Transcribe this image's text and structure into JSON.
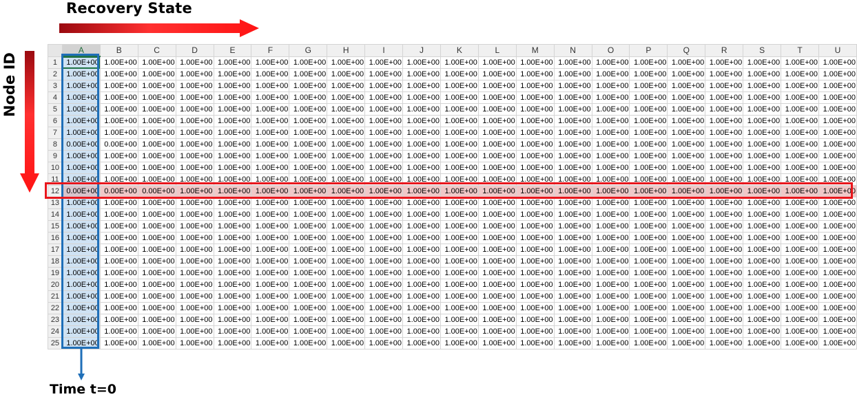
{
  "labels": {
    "top": "Recovery State",
    "left": "Node ID",
    "bottom": "Time t=0"
  },
  "colors": {
    "highlight_row_border": "#e8161c",
    "highlight_row_fill": "#f0c8c8",
    "time_column_border": "#1f6fb8",
    "time_column_fill": "#cfe2f3",
    "arrow_red": "#ff1a1a"
  },
  "spreadsheet": {
    "columns": [
      "A",
      "B",
      "C",
      "D",
      "E",
      "F",
      "G",
      "H",
      "I",
      "J",
      "K",
      "L",
      "M",
      "N",
      "O",
      "P",
      "Q",
      "R",
      "S",
      "T",
      "U"
    ],
    "highlighted_row": 12,
    "rows": [
      {
        "id": "1",
        "cells": [
          "1.00E+00",
          "1.00E+00",
          "1.00E+00",
          "1.00E+00",
          "1.00E+00",
          "1.00E+00",
          "1.00E+00",
          "1.00E+00",
          "1.00E+00",
          "1.00E+00",
          "1.00E+00",
          "1.00E+00",
          "1.00E+00",
          "1.00E+00",
          "1.00E+00",
          "1.00E+00",
          "1.00E+00",
          "1.00E+00",
          "1.00E+00",
          "1.00E+00",
          "1.00E+00"
        ]
      },
      {
        "id": "2",
        "cells": [
          "1.00E+00",
          "1.00E+00",
          "1.00E+00",
          "1.00E+00",
          "1.00E+00",
          "1.00E+00",
          "1.00E+00",
          "1.00E+00",
          "1.00E+00",
          "1.00E+00",
          "1.00E+00",
          "1.00E+00",
          "1.00E+00",
          "1.00E+00",
          "1.00E+00",
          "1.00E+00",
          "1.00E+00",
          "1.00E+00",
          "1.00E+00",
          "1.00E+00",
          "1.00E+00"
        ]
      },
      {
        "id": "3",
        "cells": [
          "1.00E+00",
          "1.00E+00",
          "1.00E+00",
          "1.00E+00",
          "1.00E+00",
          "1.00E+00",
          "1.00E+00",
          "1.00E+00",
          "1.00E+00",
          "1.00E+00",
          "1.00E+00",
          "1.00E+00",
          "1.00E+00",
          "1.00E+00",
          "1.00E+00",
          "1.00E+00",
          "1.00E+00",
          "1.00E+00",
          "1.00E+00",
          "1.00E+00",
          "1.00E+00"
        ]
      },
      {
        "id": "4",
        "cells": [
          "1.00E+00",
          "1.00E+00",
          "1.00E+00",
          "1.00E+00",
          "1.00E+00",
          "1.00E+00",
          "1.00E+00",
          "1.00E+00",
          "1.00E+00",
          "1.00E+00",
          "1.00E+00",
          "1.00E+00",
          "1.00E+00",
          "1.00E+00",
          "1.00E+00",
          "1.00E+00",
          "1.00E+00",
          "1.00E+00",
          "1.00E+00",
          "1.00E+00",
          "1.00E+00"
        ]
      },
      {
        "id": "5",
        "cells": [
          "1.00E+00",
          "1.00E+00",
          "1.00E+00",
          "1.00E+00",
          "1.00E+00",
          "1.00E+00",
          "1.00E+00",
          "1.00E+00",
          "1.00E+00",
          "1.00E+00",
          "1.00E+00",
          "1.00E+00",
          "1.00E+00",
          "1.00E+00",
          "1.00E+00",
          "1.00E+00",
          "1.00E+00",
          "1.00E+00",
          "1.00E+00",
          "1.00E+00",
          "1.00E+00"
        ]
      },
      {
        "id": "6",
        "cells": [
          "1.00E+00",
          "1.00E+00",
          "1.00E+00",
          "1.00E+00",
          "1.00E+00",
          "1.00E+00",
          "1.00E+00",
          "1.00E+00",
          "1.00E+00",
          "1.00E+00",
          "1.00E+00",
          "1.00E+00",
          "1.00E+00",
          "1.00E+00",
          "1.00E+00",
          "1.00E+00",
          "1.00E+00",
          "1.00E+00",
          "1.00E+00",
          "1.00E+00",
          "1.00E+00"
        ]
      },
      {
        "id": "7",
        "cells": [
          "1.00E+00",
          "1.00E+00",
          "1.00E+00",
          "1.00E+00",
          "1.00E+00",
          "1.00E+00",
          "1.00E+00",
          "1.00E+00",
          "1.00E+00",
          "1.00E+00",
          "1.00E+00",
          "1.00E+00",
          "1.00E+00",
          "1.00E+00",
          "1.00E+00",
          "1.00E+00",
          "1.00E+00",
          "1.00E+00",
          "1.00E+00",
          "1.00E+00",
          "1.00E+00"
        ]
      },
      {
        "id": "8",
        "cells": [
          "0.00E+00",
          "0.00E+00",
          "1.00E+00",
          "1.00E+00",
          "1.00E+00",
          "1.00E+00",
          "1.00E+00",
          "1.00E+00",
          "1.00E+00",
          "1.00E+00",
          "1.00E+00",
          "1.00E+00",
          "1.00E+00",
          "1.00E+00",
          "1.00E+00",
          "1.00E+00",
          "1.00E+00",
          "1.00E+00",
          "1.00E+00",
          "1.00E+00",
          "1.00E+00"
        ]
      },
      {
        "id": "9",
        "cells": [
          "1.00E+00",
          "1.00E+00",
          "1.00E+00",
          "1.00E+00",
          "1.00E+00",
          "1.00E+00",
          "1.00E+00",
          "1.00E+00",
          "1.00E+00",
          "1.00E+00",
          "1.00E+00",
          "1.00E+00",
          "1.00E+00",
          "1.00E+00",
          "1.00E+00",
          "1.00E+00",
          "1.00E+00",
          "1.00E+00",
          "1.00E+00",
          "1.00E+00",
          "1.00E+00"
        ]
      },
      {
        "id": "10",
        "cells": [
          "1.00E+00",
          "1.00E+00",
          "1.00E+00",
          "1.00E+00",
          "1.00E+00",
          "1.00E+00",
          "1.00E+00",
          "1.00E+00",
          "1.00E+00",
          "1.00E+00",
          "1.00E+00",
          "1.00E+00",
          "1.00E+00",
          "1.00E+00",
          "1.00E+00",
          "1.00E+00",
          "1.00E+00",
          "1.00E+00",
          "1.00E+00",
          "1.00E+00",
          "1.00E+00"
        ]
      },
      {
        "id": "11",
        "cells": [
          "1.00E+00",
          "1.00E+00",
          "1.00E+00",
          "1.00E+00",
          "1.00E+00",
          "1.00E+00",
          "1.00E+00",
          "1.00E+00",
          "1.00E+00",
          "1.00E+00",
          "1.00E+00",
          "1.00E+00",
          "1.00E+00",
          "1.00E+00",
          "1.00E+00",
          "1.00E+00",
          "1.00E+00",
          "1.00E+00",
          "1.00E+00",
          "1.00E+00",
          "1.00E+00"
        ]
      },
      {
        "id": "12",
        "cells": [
          "0.00E+00",
          "0.00E+00",
          "0.00E+00",
          "1.00E+00",
          "1.00E+00",
          "1.00E+00",
          "1.00E+00",
          "1.00E+00",
          "1.00E+00",
          "1.00E+00",
          "1.00E+00",
          "1.00E+00",
          "1.00E+00",
          "1.00E+00",
          "1.00E+00",
          "1.00E+00",
          "1.00E+00",
          "1.00E+00",
          "1.00E+00",
          "1.00E+00",
          "1.00E+00"
        ]
      },
      {
        "id": "13",
        "cells": [
          "1.00E+00",
          "1.00E+00",
          "1.00E+00",
          "1.00E+00",
          "1.00E+00",
          "1.00E+00",
          "1.00E+00",
          "1.00E+00",
          "1.00E+00",
          "1.00E+00",
          "1.00E+00",
          "1.00E+00",
          "1.00E+00",
          "1.00E+00",
          "1.00E+00",
          "1.00E+00",
          "1.00E+00",
          "1.00E+00",
          "1.00E+00",
          "1.00E+00",
          "1.00E+00"
        ]
      },
      {
        "id": "14",
        "cells": [
          "1.00E+00",
          "1.00E+00",
          "1.00E+00",
          "1.00E+00",
          "1.00E+00",
          "1.00E+00",
          "1.00E+00",
          "1.00E+00",
          "1.00E+00",
          "1.00E+00",
          "1.00E+00",
          "1.00E+00",
          "1.00E+00",
          "1.00E+00",
          "1.00E+00",
          "1.00E+00",
          "1.00E+00",
          "1.00E+00",
          "1.00E+00",
          "1.00E+00",
          "1.00E+00"
        ]
      },
      {
        "id": "15",
        "cells": [
          "1.00E+00",
          "1.00E+00",
          "1.00E+00",
          "1.00E+00",
          "1.00E+00",
          "1.00E+00",
          "1.00E+00",
          "1.00E+00",
          "1.00E+00",
          "1.00E+00",
          "1.00E+00",
          "1.00E+00",
          "1.00E+00",
          "1.00E+00",
          "1.00E+00",
          "1.00E+00",
          "1.00E+00",
          "1.00E+00",
          "1.00E+00",
          "1.00E+00",
          "1.00E+00"
        ]
      },
      {
        "id": "16",
        "cells": [
          "1.00E+00",
          "1.00E+00",
          "1.00E+00",
          "1.00E+00",
          "1.00E+00",
          "1.00E+00",
          "1.00E+00",
          "1.00E+00",
          "1.00E+00",
          "1.00E+00",
          "1.00E+00",
          "1.00E+00",
          "1.00E+00",
          "1.00E+00",
          "1.00E+00",
          "1.00E+00",
          "1.00E+00",
          "1.00E+00",
          "1.00E+00",
          "1.00E+00",
          "1.00E+00"
        ]
      },
      {
        "id": "17",
        "cells": [
          "1.00E+00",
          "1.00E+00",
          "1.00E+00",
          "1.00E+00",
          "1.00E+00",
          "1.00E+00",
          "1.00E+00",
          "1.00E+00",
          "1.00E+00",
          "1.00E+00",
          "1.00E+00",
          "1.00E+00",
          "1.00E+00",
          "1.00E+00",
          "1.00E+00",
          "1.00E+00",
          "1.00E+00",
          "1.00E+00",
          "1.00E+00",
          "1.00E+00",
          "1.00E+00"
        ]
      },
      {
        "id": "18",
        "cells": [
          "1.00E+00",
          "1.00E+00",
          "1.00E+00",
          "1.00E+00",
          "1.00E+00",
          "1.00E+00",
          "1.00E+00",
          "1.00E+00",
          "1.00E+00",
          "1.00E+00",
          "1.00E+00",
          "1.00E+00",
          "1.00E+00",
          "1.00E+00",
          "1.00E+00",
          "1.00E+00",
          "1.00E+00",
          "1.00E+00",
          "1.00E+00",
          "1.00E+00",
          "1.00E+00"
        ]
      },
      {
        "id": "19",
        "cells": [
          "1.00E+00",
          "1.00E+00",
          "1.00E+00",
          "1.00E+00",
          "1.00E+00",
          "1.00E+00",
          "1.00E+00",
          "1.00E+00",
          "1.00E+00",
          "1.00E+00",
          "1.00E+00",
          "1.00E+00",
          "1.00E+00",
          "1.00E+00",
          "1.00E+00",
          "1.00E+00",
          "1.00E+00",
          "1.00E+00",
          "1.00E+00",
          "1.00E+00",
          "1.00E+00"
        ]
      },
      {
        "id": "20",
        "cells": [
          "1.00E+00",
          "1.00E+00",
          "1.00E+00",
          "1.00E+00",
          "1.00E+00",
          "1.00E+00",
          "1.00E+00",
          "1.00E+00",
          "1.00E+00",
          "1.00E+00",
          "1.00E+00",
          "1.00E+00",
          "1.00E+00",
          "1.00E+00",
          "1.00E+00",
          "1.00E+00",
          "1.00E+00",
          "1.00E+00",
          "1.00E+00",
          "1.00E+00",
          "1.00E+00"
        ]
      },
      {
        "id": "21",
        "cells": [
          "1.00E+00",
          "1.00E+00",
          "1.00E+00",
          "1.00E+00",
          "1.00E+00",
          "1.00E+00",
          "1.00E+00",
          "1.00E+00",
          "1.00E+00",
          "1.00E+00",
          "1.00E+00",
          "1.00E+00",
          "1.00E+00",
          "1.00E+00",
          "1.00E+00",
          "1.00E+00",
          "1.00E+00",
          "1.00E+00",
          "1.00E+00",
          "1.00E+00",
          "1.00E+00"
        ]
      },
      {
        "id": "22",
        "cells": [
          "1.00E+00",
          "1.00E+00",
          "1.00E+00",
          "1.00E+00",
          "1.00E+00",
          "1.00E+00",
          "1.00E+00",
          "1.00E+00",
          "1.00E+00",
          "1.00E+00",
          "1.00E+00",
          "1.00E+00",
          "1.00E+00",
          "1.00E+00",
          "1.00E+00",
          "1.00E+00",
          "1.00E+00",
          "1.00E+00",
          "1.00E+00",
          "1.00E+00",
          "1.00E+00"
        ]
      },
      {
        "id": "23",
        "cells": [
          "1.00E+00",
          "1.00E+00",
          "1.00E+00",
          "1.00E+00",
          "1.00E+00",
          "1.00E+00",
          "1.00E+00",
          "1.00E+00",
          "1.00E+00",
          "1.00E+00",
          "1.00E+00",
          "1.00E+00",
          "1.00E+00",
          "1.00E+00",
          "1.00E+00",
          "1.00E+00",
          "1.00E+00",
          "1.00E+00",
          "1.00E+00",
          "1.00E+00",
          "1.00E+00"
        ]
      },
      {
        "id": "24",
        "cells": [
          "1.00E+00",
          "1.00E+00",
          "1.00E+00",
          "1.00E+00",
          "1.00E+00",
          "1.00E+00",
          "1.00E+00",
          "1.00E+00",
          "1.00E+00",
          "1.00E+00",
          "1.00E+00",
          "1.00E+00",
          "1.00E+00",
          "1.00E+00",
          "1.00E+00",
          "1.00E+00",
          "1.00E+00",
          "1.00E+00",
          "1.00E+00",
          "1.00E+00",
          "1.00E+00"
        ]
      },
      {
        "id": "25",
        "cells": [
          "1.00E+00",
          "1.00E+00",
          "1.00E+00",
          "1.00E+00",
          "1.00E+00",
          "1.00E+00",
          "1.00E+00",
          "1.00E+00",
          "1.00E+00",
          "1.00E+00",
          "1.00E+00",
          "1.00E+00",
          "1.00E+00",
          "1.00E+00",
          "1.00E+00",
          "1.00E+00",
          "1.00E+00",
          "1.00E+00",
          "1.00E+00",
          "1.00E+00",
          "1.00E+00"
        ]
      }
    ]
  }
}
